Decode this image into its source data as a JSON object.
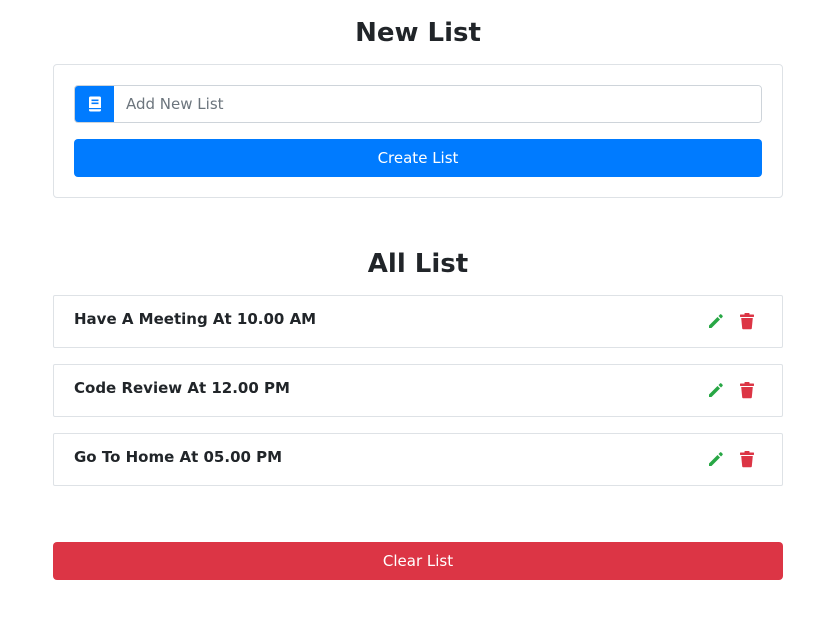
{
  "new_list": {
    "title": "New List",
    "input": {
      "placeholder": "Add New List",
      "value": "",
      "icon": "book-icon"
    },
    "create_label": "Create List"
  },
  "all_list": {
    "title": "All List",
    "items": [
      {
        "text": "Have A Meeting At 10.00 AM"
      },
      {
        "text": "Code Review At 12.00 PM"
      },
      {
        "text": "Go To Home At 05.00 PM"
      }
    ],
    "edit_icon": "pencil-icon",
    "delete_icon": "trash-icon"
  },
  "clear_label": "Clear List",
  "colors": {
    "primary": "#007bff",
    "danger": "#dc3545",
    "success": "#28a745",
    "border": "#dee2e6"
  }
}
